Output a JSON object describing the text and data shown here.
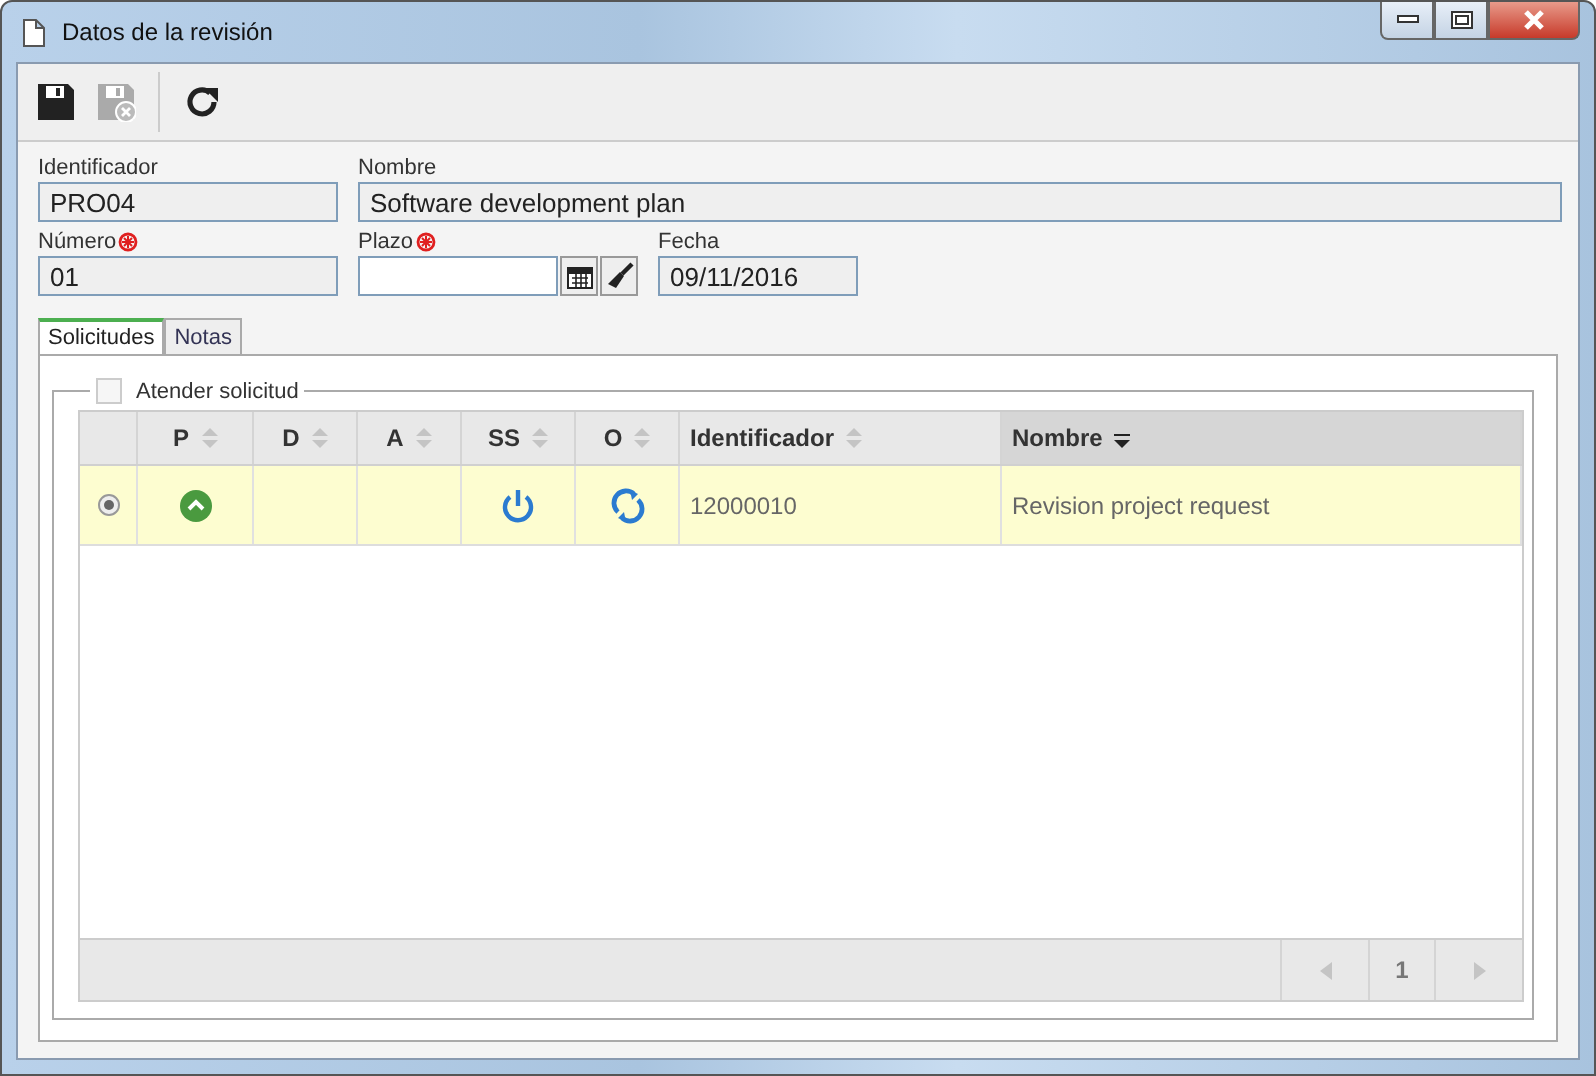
{
  "window": {
    "title": "Datos de la revisión"
  },
  "toolbar": [
    {
      "kind": "save",
      "disabled": false
    },
    {
      "kind": "save-cancel",
      "disabled": true
    },
    {
      "kind": "refresh",
      "disabled": false
    }
  ],
  "fields": [
    {
      "kind": "text",
      "label": "Identificador",
      "value": "PRO04",
      "required": false,
      "readonly": true
    },
    {
      "kind": "text",
      "label": "Nombre",
      "value": "Software development plan",
      "required": false,
      "readonly": true
    },
    {
      "kind": "text",
      "label": "Número",
      "value": "01",
      "required": true,
      "readonly": true
    },
    {
      "kind": "date",
      "label": "Plazo",
      "required": true,
      "readonly": false
    },
    {
      "kind": "text",
      "label": "Fecha",
      "value": "09/11/2016",
      "required": false,
      "readonly": true
    }
  ],
  "tabs": [
    {
      "label": "Solicitudes",
      "selected": true
    },
    {
      "label": "Notas",
      "selected": false
    }
  ],
  "attend": {
    "label": "Atender solicitud",
    "checked": false
  },
  "table": {
    "columns": [
      {
        "label": "P",
        "sorted": false
      },
      {
        "label": "D",
        "sorted": false
      },
      {
        "label": "A",
        "sorted": false
      },
      {
        "label": "SS",
        "sorted": false
      },
      {
        "label": "O",
        "sorted": false
      },
      {
        "label": "Identificador",
        "sorted": false
      },
      {
        "label": "Nombre",
        "sorted": true
      }
    ],
    "rows": [
      {
        "selected": true,
        "cells": [
          {
            "kind": "up"
          },
          {
            "kind": "empty"
          },
          {
            "kind": "empty"
          },
          {
            "kind": "power"
          },
          {
            "kind": "sync"
          },
          {
            "kind": "text",
            "text": "12000010"
          },
          {
            "kind": "text",
            "text": "Revision project request"
          }
        ]
      }
    ]
  },
  "pager": {
    "page": "1",
    "prev_disabled": true,
    "next_disabled": true
  }
}
